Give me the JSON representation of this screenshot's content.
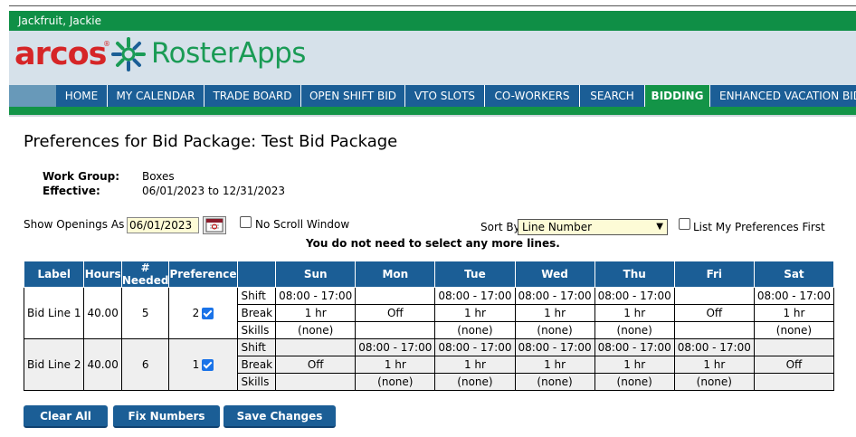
{
  "header": {
    "user_name": "Jackfruit, Jackie",
    "logo_primary": "arcos",
    "logo_reg": "®",
    "logo_secondary": "RosterApps"
  },
  "nav": {
    "tabs": [
      {
        "label": "HOME",
        "active": false
      },
      {
        "label": "MY CALENDAR",
        "active": false
      },
      {
        "label": "TRADE BOARD",
        "active": false
      },
      {
        "label": "OPEN SHIFT BID",
        "active": false
      },
      {
        "label": "VTO SLOTS",
        "active": false
      },
      {
        "label": "CO-WORKERS",
        "active": false
      },
      {
        "label": "SEARCH",
        "active": false
      },
      {
        "label": "BIDDING",
        "active": true
      },
      {
        "label": "ENHANCED VACATION BID",
        "active": false
      }
    ]
  },
  "page": {
    "title": "Preferences for Bid Package: Test Bid Package",
    "work_group_label": "Work Group:",
    "work_group_value": "Boxes",
    "effective_label": "Effective:",
    "effective_value": "06/01/2023 to 12/31/2023"
  },
  "controls": {
    "openings_label": "Show Openings As Of",
    "openings_date": "06/01/2023",
    "calendar_icon": "calendar-icon",
    "no_scroll_label": "No Scroll Window",
    "no_scroll_checked": false,
    "sort_label": "Sort By",
    "sort_value": "Line Number",
    "list_first_label": "List My Preferences First",
    "list_first_checked": false,
    "notice": "You do not need to select any more lines."
  },
  "table": {
    "headers": [
      "Label",
      "Hours",
      "# Needed",
      "Preference",
      "",
      "Sun",
      "Mon",
      "Tue",
      "Wed",
      "Thu",
      "Fri",
      "Sat"
    ],
    "rows": [
      {
        "label": "Bid Line 1",
        "hours": "40.00",
        "needed": "5",
        "preference": "2",
        "checked": true,
        "shift": [
          "08:00 - 17:00",
          "",
          "08:00 - 17:00",
          "08:00 - 17:00",
          "08:00 - 17:00",
          "",
          "08:00 - 17:00"
        ],
        "break": [
          "1 hr",
          "Off",
          "1 hr",
          "1 hr",
          "1 hr",
          "Off",
          "1 hr"
        ],
        "skills": [
          "(none)",
          "",
          "(none)",
          "(none)",
          "(none)",
          "",
          "(none)"
        ]
      },
      {
        "label": "Bid Line 2",
        "hours": "40.00",
        "needed": "6",
        "preference": "1",
        "checked": true,
        "shift": [
          "",
          "08:00 - 17:00",
          "08:00 - 17:00",
          "08:00 - 17:00",
          "08:00 - 17:00",
          "08:00 - 17:00",
          ""
        ],
        "break": [
          "Off",
          "1 hr",
          "1 hr",
          "1 hr",
          "1 hr",
          "1 hr",
          "Off"
        ],
        "skills": [
          "",
          "(none)",
          "(none)",
          "(none)",
          "(none)",
          "(none)",
          ""
        ]
      }
    ],
    "row_types": [
      "Shift",
      "Break",
      "Skills"
    ]
  },
  "buttons": {
    "clear_all": "Clear All",
    "fix_numbers": "Fix Numbers",
    "save_changes": "Save Changes"
  },
  "colors": {
    "brand_green": "#139447",
    "nav_blue": "#1b5e96",
    "logo_red": "#d62527"
  }
}
